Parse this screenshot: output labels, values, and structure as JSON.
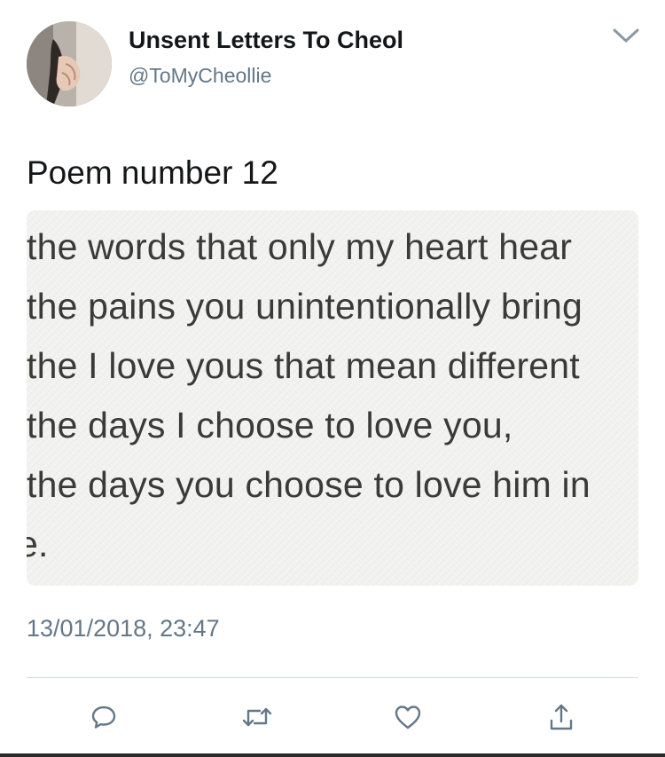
{
  "tweet": {
    "display_name": "Unsent Letters To Cheol",
    "handle": "@ToMyCheollie",
    "text": "Poem number 12",
    "timestamp": "13/01/2018, 23:47"
  },
  "media": {
    "lines": [
      "the words that only my heart hear",
      "the pains you unintentionally bring",
      "the I love yous that mean different",
      "the days I choose to love you,",
      "the days you choose to love him in",
      "e."
    ]
  },
  "actions": {
    "reply_icon": "reply-icon",
    "retweet_icon": "retweet-icon",
    "like_icon": "heart-icon",
    "share_icon": "share-icon"
  },
  "colors": {
    "text": "#14171a",
    "secondary": "#657786",
    "icon": "#657786",
    "divider": "#d4dbe0"
  }
}
